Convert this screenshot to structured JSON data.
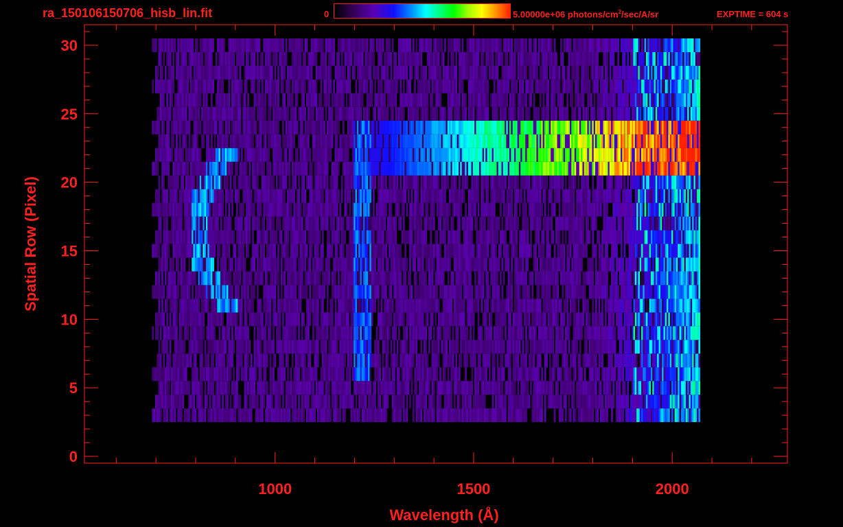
{
  "header": {
    "filename": "ra_150106150706_hisb_lin.fit",
    "colorbar_min": "0",
    "colorbar_max_prefix": "5.00000e+06 photons/cm",
    "colorbar_max_sup": "2",
    "colorbar_max_suffix": "/sec/A/sr",
    "exptime": "EXPTIME = 604 s"
  },
  "colors": {
    "axis": "#ff2020",
    "background": "#000000"
  },
  "chart_data": {
    "type": "heatmap",
    "title": "ra_150106150706_hisb_lin.fit",
    "xlabel": "Wavelength (Å)",
    "ylabel": "Spatial Row (Pixel)",
    "xlim": [
      520,
      2290
    ],
    "ylim": [
      -0.5,
      31.5
    ],
    "x_ticks": [
      1000,
      1500,
      2000
    ],
    "x_tick_labels": [
      "1000",
      "1500",
      "2000"
    ],
    "y_ticks": [
      0,
      5,
      10,
      15,
      20,
      25,
      30
    ],
    "y_tick_labels": [
      "0",
      "5",
      "10",
      "15",
      "20",
      "25",
      "30"
    ],
    "colorscale": {
      "min": 0,
      "max": 5000000,
      "units": "photons/cm^2/sec/A/sr"
    },
    "data_extent": {
      "wavelength": [
        690,
        2070
      ],
      "rows": [
        3,
        30
      ]
    },
    "features": [
      {
        "name": "curved emission arc",
        "wavelength_range": [
          790,
          930
        ],
        "rows": [
          11,
          22
        ],
        "intensity_fraction": 0.45
      },
      {
        "name": "vertical line near 1216",
        "wavelength_range": [
          1195,
          1240
        ],
        "rows": [
          6,
          24
        ],
        "intensity_fraction": 0.4
      },
      {
        "name": "bright horizontal band",
        "wavelength_range": [
          1240,
          2070
        ],
        "rows": [
          21,
          24
        ],
        "intensity_fraction": 0.75
      },
      {
        "name": "long-wavelength edge",
        "wavelength_range": [
          1900,
          2070
        ],
        "rows": [
          2,
          30
        ],
        "intensity_fraction": 0.55
      }
    ]
  }
}
